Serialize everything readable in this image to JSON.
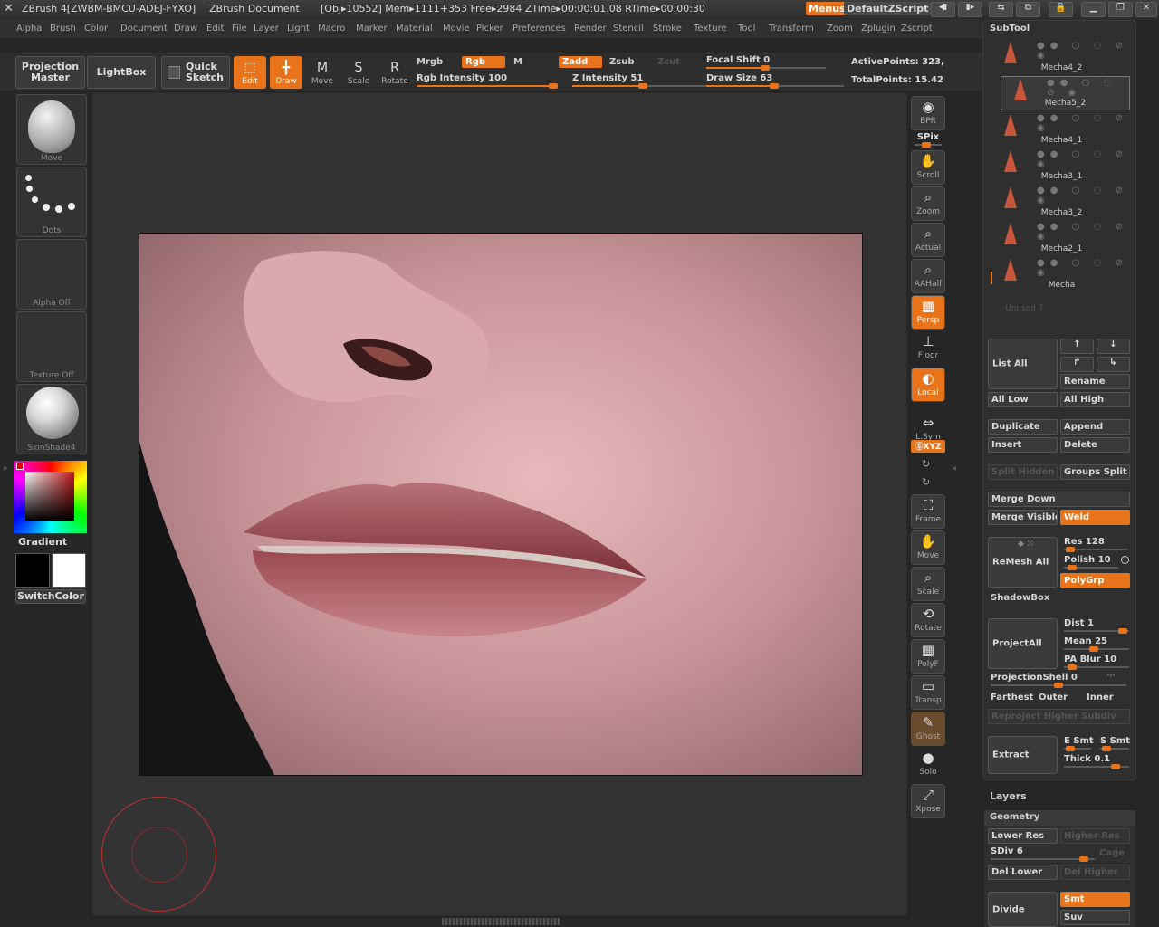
{
  "titlebar": {
    "app": "ZBrush 4[ZWBM-BMCU-ADEJ-FYXO]",
    "document": "ZBrush Document",
    "stats": "[Obj▸10552] Mem▸1111+353 Free▸2984 ZTime▸00:00:01.08 RTime▸00:00:30",
    "menus_btn": "Menus",
    "script": "DefaultZScript"
  },
  "menubar": [
    "Alpha",
    "Brush",
    "Color",
    "Document",
    "Draw",
    "Edit",
    "File",
    "Layer",
    "Light",
    "Macro",
    "Marker",
    "Material",
    "Movie",
    "Picker",
    "Preferences",
    "Render",
    "Stencil",
    "Stroke",
    "Texture",
    "Tool",
    "Transform",
    "Zoom",
    "Zplugin",
    "Zscript"
  ],
  "toolbar": {
    "projection_master": "Projection Master",
    "lightbox": "LightBox",
    "quick_sketch": "Quick Sketch",
    "tools": [
      {
        "label": "Edit",
        "icon": "edit-icon",
        "glyph": "⬚",
        "active": true
      },
      {
        "label": "Draw",
        "icon": "draw-icon",
        "glyph": "╋",
        "active": true
      },
      {
        "label": "Move",
        "icon": "move-icon",
        "glyph": "M",
        "active": false
      },
      {
        "label": "Scale",
        "icon": "scale-icon",
        "glyph": "S",
        "active": false
      },
      {
        "label": "Rotate",
        "icon": "rotate-icon",
        "glyph": "R",
        "active": false
      }
    ],
    "mrgb": "Mrgb",
    "rgb": "Rgb",
    "m": "M",
    "zadd": "Zadd",
    "zsub": "Zsub",
    "zcut": "Zcut",
    "rgb_intensity": "Rgb Intensity 100",
    "z_intensity": "Z Intensity 51",
    "focal_shift": "Focal Shift 0",
    "draw_size": "Draw Size 63",
    "active_points": "ActivePoints: 323,",
    "total_points": "TotalPoints: 15.42"
  },
  "sliders": {
    "rgb_intensity": 1.0,
    "z_intensity": 0.51,
    "focal_shift": 0.5,
    "draw_size": 0.5
  },
  "left": {
    "brush": "Move",
    "stroke": "Dots",
    "alpha": "Alpha  Off",
    "texture": "Texture  Off",
    "material": "SkinShade4",
    "gradient": "Gradient",
    "switch_color": "SwitchColor"
  },
  "rightstrip": {
    "bpr": "BPR",
    "spix": "SPix",
    "scroll": "Scroll",
    "zoom": "Zoom",
    "actual": "Actual",
    "aahalf": "AAHalf",
    "persp": "Persp",
    "floor": "Floor",
    "local": "Local",
    "lsym": "L.Sym",
    "xyz": "ⓈXYZ",
    "frame": "Frame",
    "move": "Move",
    "scale": "Scale",
    "rotate": "Rotate",
    "polyf": "PolyF",
    "transp": "Transp",
    "ghost": "Ghost",
    "solo": "Solo",
    "xpose": "Xpose"
  },
  "subtool": {
    "title": "SubTool",
    "items": [
      "Mecha4_2",
      "Mecha5_2",
      "Mecha4_1",
      "Mecha3_1",
      "Mecha3_2",
      "Mecha2_1",
      "Mecha"
    ],
    "unused": "Unused  7",
    "list_all": "List  All",
    "rename": "Rename",
    "all_low": "All  Low",
    "all_high": "All  High",
    "duplicate": "Duplicate",
    "append": "Append",
    "insert": "Insert",
    "delete": "Delete",
    "split_hidden": "Split  Hidden",
    "groups_split": "Groups  Split",
    "merge_down": "Merge  Down",
    "merge_visible": "Merge  Visible",
    "weld": "Weld",
    "remesh_all": "ReMesh  All",
    "res": "Res 128",
    "polish": "Polish 10",
    "polygrp": "PolyGrp",
    "shadowbox": "ShadowBox",
    "project_all": "ProjectAll",
    "dist": "Dist 1",
    "mean": "Mean 25",
    "pa_blur": "PA  Blur 10",
    "projection_shell": "ProjectionShell 0",
    "farthest": "Farthest",
    "outer": "Outer",
    "inner": "Inner",
    "reproject": "Reproject  Higher  Subdiv",
    "extract": "Extract",
    "e_smt": "E  Smt",
    "s_smt": "S  Smt",
    "thick": "Thick 0.1"
  },
  "layers": {
    "title": "Layers"
  },
  "geometry": {
    "title": "Geometry",
    "lower_res": "Lower  Res",
    "higher_res": "Higher  Res",
    "sdiv": "SDiv 6",
    "cage": "Cage",
    "del_lower": "Del  Lower",
    "del_higher": "Del  Higher",
    "divide": "Divide",
    "smt": "Smt",
    "suv": "Suv"
  },
  "colors": {
    "accent": "#e8731a",
    "panel": "#2f2f2f",
    "background": "#262626"
  }
}
